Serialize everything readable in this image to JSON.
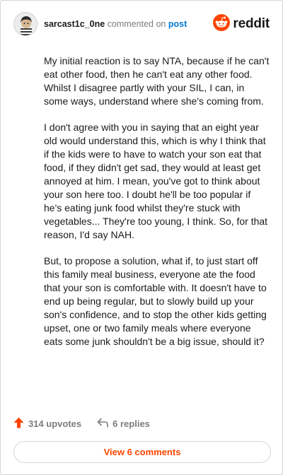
{
  "header": {
    "username": "sarcast1c_0ne",
    "action_text": "commented on",
    "target_text": "post",
    "brand": "reddit"
  },
  "comment": {
    "paragraphs": [
      "My initial reaction is to say NTA, because if he can't eat other food, then he can't eat any other food. Whilst I disagree partly with your SIL, I can, in some ways, understand where she's coming from.",
      "I don't agree with you in saying that an eight year old would understand this, which is why I think that if the kids were to have to watch your son eat that food, if they didn't get sad, they would at least get annoyed at him. I mean, you've got to think about your son here too. I doubt he'll be too popular if he's eating junk food whilst they're stuck with vegetables... They're too young, I think. So, for that reason, I'd say NAH.",
      "But, to propose a solution, what if, to just start off this family meal business, everyone ate the food that your son is comfortable with. It doesn't have to end up being regular, but to slowly build up your son's confidence, and to stop the other kids getting upset, one or two family meals where everyone eats some junk shouldn't be a big issue, should it?"
    ]
  },
  "footer": {
    "upvotes": "314 upvotes",
    "replies": "6 replies",
    "view_comments": "View 6 comments"
  },
  "colors": {
    "brand": "#ff4500",
    "link": "#0079d3",
    "muted": "#7c7c7c"
  },
  "icons": {
    "avatar": "user-avatar",
    "brand": "reddit-logo-icon",
    "upvote": "upvote-arrow-icon",
    "reply": "reply-arrow-icon"
  }
}
